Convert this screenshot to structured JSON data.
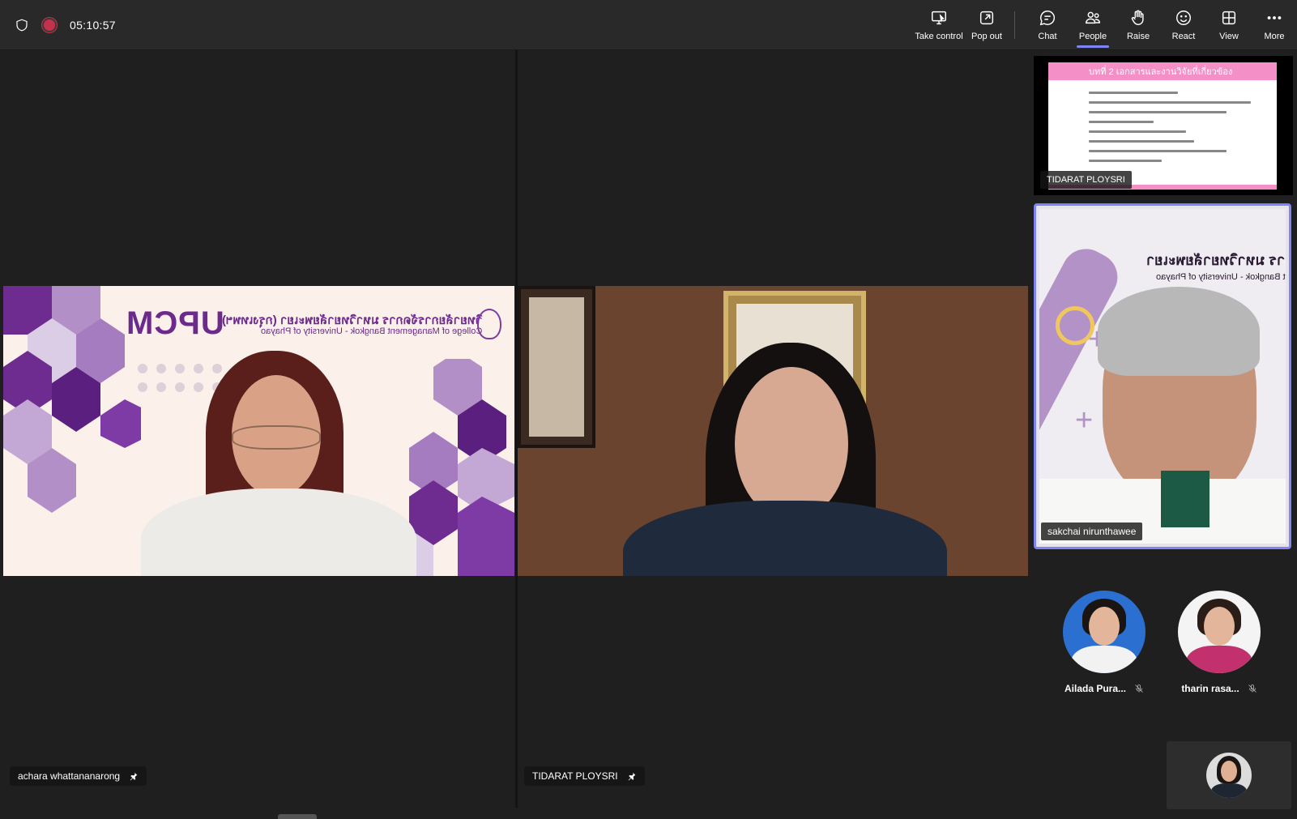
{
  "call": {
    "timer": "05:10:57"
  },
  "toolbar": [
    {
      "label": "Take control",
      "icon": "take-control-icon"
    },
    {
      "label": "Pop out",
      "icon": "pop-out-icon"
    },
    {
      "label": "Chat",
      "icon": "chat-icon"
    },
    {
      "label": "People",
      "icon": "people-icon",
      "active": true
    },
    {
      "label": "Raise",
      "icon": "raise-hand-icon"
    },
    {
      "label": "React",
      "icon": "react-icon"
    },
    {
      "label": "View",
      "icon": "view-icon"
    },
    {
      "label": "More",
      "icon": "more-icon"
    }
  ],
  "stage": {
    "tiles": [
      {
        "participant": "achara whattananarong",
        "pinned": true,
        "background": {
          "logo": "UPCM",
          "college_th": "วิทยาลัยการจัดการ มหาวิทยาลัยพะเยา (กรุงเทพฯ)",
          "college_en": "College of Management Bangkok - University of Phayao"
        }
      },
      {
        "participant": "TIDARAT PLOYSRI",
        "pinned": true
      }
    ]
  },
  "rail": {
    "screen_share": {
      "presenter": "TIDARAT PLOYSRI",
      "slide_title": "บทที่ 2 เอกสารและงานวิจัยที่เกี่ยวข้อง"
    },
    "active_speaker": {
      "name": "sakchai nirunthawee",
      "background_th": "การ มหาวิทยาลัยพะเยา",
      "background_en": "t Bangkok - University of Phayao"
    },
    "audio_participants": [
      {
        "name": "Ailada Pura...",
        "muted": true
      },
      {
        "name": "tharin rasa...",
        "muted": true
      }
    ]
  },
  "colors": {
    "accent": "#7f85f5",
    "recording": "#c4314b",
    "topbar": "#292929",
    "stage": "#1f1f1f"
  }
}
